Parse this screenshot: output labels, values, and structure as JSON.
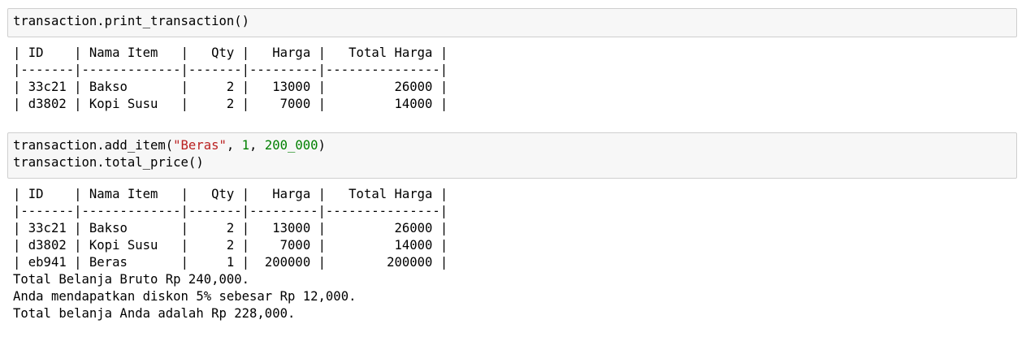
{
  "cells": [
    {
      "input_lines": [
        [
          {
            "t": "transaction.print_transaction()",
            "k": "plain"
          }
        ]
      ],
      "table": {
        "header": [
          "ID",
          "Nama Item",
          "Qty",
          "Harga",
          "Total Harga"
        ],
        "separator": "|-------|-------------|-------|---------|---------------|",
        "rows": [
          [
            "33c21",
            "Bakso",
            "2",
            "13000",
            "26000"
          ],
          [
            "d3802",
            "Kopi Susu",
            "2",
            "7000",
            "14000"
          ]
        ]
      },
      "extra_output": []
    },
    {
      "input_lines": [
        [
          {
            "t": "transaction.add_item(",
            "k": "plain"
          },
          {
            "t": "\"Beras\"",
            "k": "str"
          },
          {
            "t": ", ",
            "k": "plain"
          },
          {
            "t": "1",
            "k": "num"
          },
          {
            "t": ", ",
            "k": "plain"
          },
          {
            "t": "200_000",
            "k": "num"
          },
          {
            "t": ")",
            "k": "plain"
          }
        ],
        [
          {
            "t": "transaction.total_price()",
            "k": "plain"
          }
        ]
      ],
      "table": {
        "header": [
          "ID",
          "Nama Item",
          "Qty",
          "Harga",
          "Total Harga"
        ],
        "separator": "|-------|-------------|-------|---------|---------------|",
        "rows": [
          [
            "33c21",
            "Bakso",
            "2",
            "13000",
            "26000"
          ],
          [
            "d3802",
            "Kopi Susu",
            "2",
            "7000",
            "14000"
          ],
          [
            "eb941",
            "Beras",
            "1",
            "200000",
            "200000"
          ]
        ]
      },
      "extra_output": [
        "Total Belanja Bruto Rp 240,000.",
        "Anda mendapatkan diskon 5% sebesar Rp 12,000.",
        "Total belanja Anda adalah Rp 228,000."
      ]
    }
  ]
}
